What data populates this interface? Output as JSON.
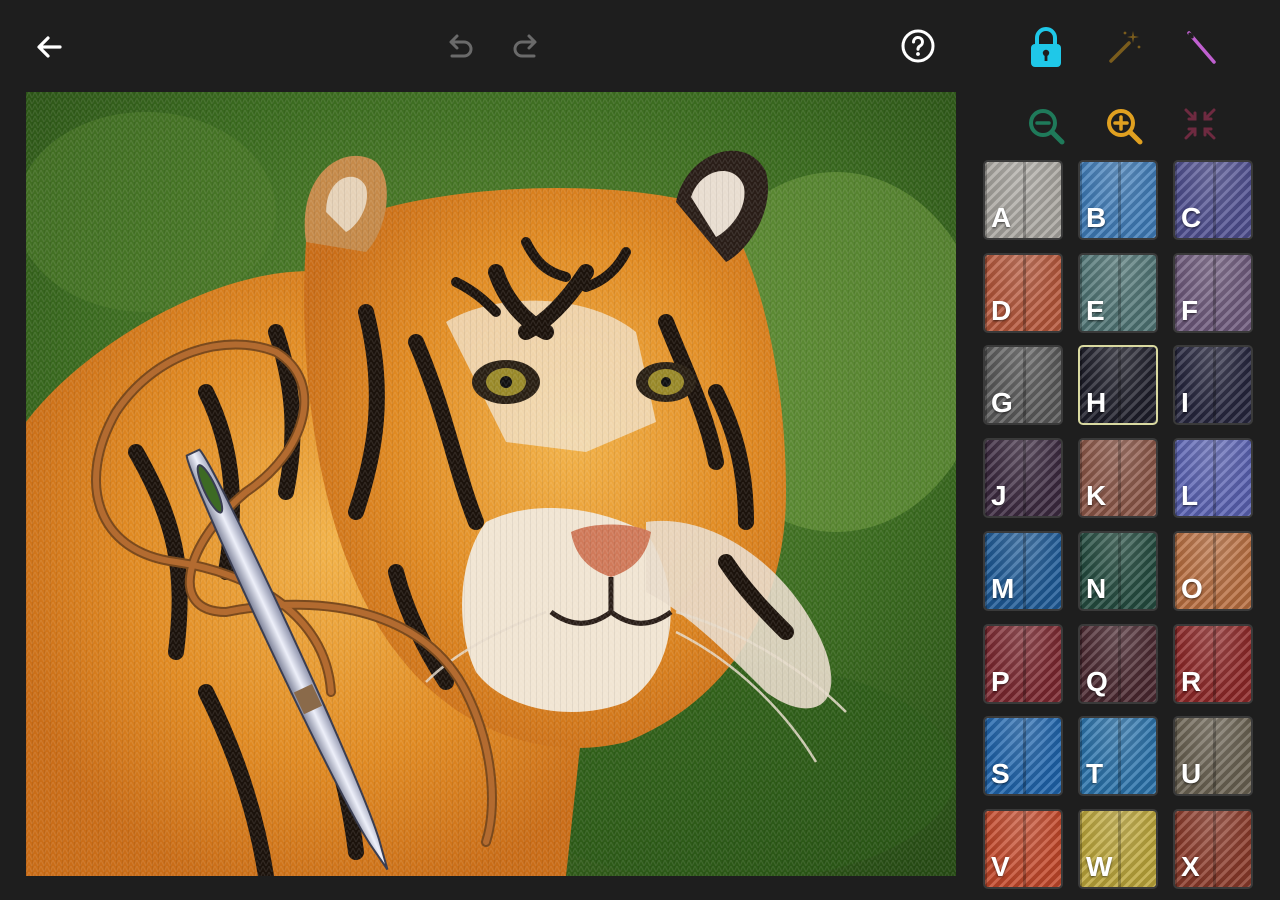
{
  "toolbar": {
    "back_icon": "arrow-left-icon",
    "undo_icon": "undo-icon",
    "redo_icon": "redo-icon",
    "help_icon": "help-circle-icon",
    "lock_icon": "lock-icon",
    "magic_wand_icon": "magic-wand-icon",
    "needle_icon": "needle-icon",
    "zoom_out_icon": "zoom-out-icon",
    "zoom_in_icon": "zoom-in-icon",
    "fit_icon": "collapse-icon"
  },
  "colors": {
    "background": "#1e1e1e",
    "lock": "#1fc8e8",
    "zoom_out": "#1f7a5a",
    "zoom_in": "#e0a020",
    "needle": "#c060d0",
    "wand": "#8a6a20"
  },
  "canvas": {
    "image": "cross-stitch tiger"
  },
  "palette": {
    "selected": "H",
    "swatches": [
      {
        "letter": "A",
        "color": "#a9a6a0"
      },
      {
        "letter": "B",
        "color": "#3f7cb8"
      },
      {
        "letter": "C",
        "color": "#4f4f8f"
      },
      {
        "letter": "D",
        "color": "#b5563a"
      },
      {
        "letter": "E",
        "color": "#4f7474"
      },
      {
        "letter": "F",
        "color": "#6e5a7c"
      },
      {
        "letter": "G",
        "color": "#5a5a5a"
      },
      {
        "letter": "H",
        "color": "#1e1e2a"
      },
      {
        "letter": "I",
        "color": "#26263e"
      },
      {
        "letter": "J",
        "color": "#3c2a40"
      },
      {
        "letter": "K",
        "color": "#8a5546"
      },
      {
        "letter": "L",
        "color": "#5a62b2"
      },
      {
        "letter": "M",
        "color": "#1e5a96"
      },
      {
        "letter": "N",
        "color": "#244c40"
      },
      {
        "letter": "O",
        "color": "#b86e40"
      },
      {
        "letter": "P",
        "color": "#7c2830"
      },
      {
        "letter": "Q",
        "color": "#4a2830"
      },
      {
        "letter": "R",
        "color": "#8e2828"
      },
      {
        "letter": "S",
        "color": "#1f64ac"
      },
      {
        "letter": "T",
        "color": "#2a72aa"
      },
      {
        "letter": "U",
        "color": "#6a6252"
      },
      {
        "letter": "V",
        "color": "#c2482a"
      },
      {
        "letter": "W",
        "color": "#bca63a"
      },
      {
        "letter": "X",
        "color": "#8a3a2a"
      }
    ]
  }
}
